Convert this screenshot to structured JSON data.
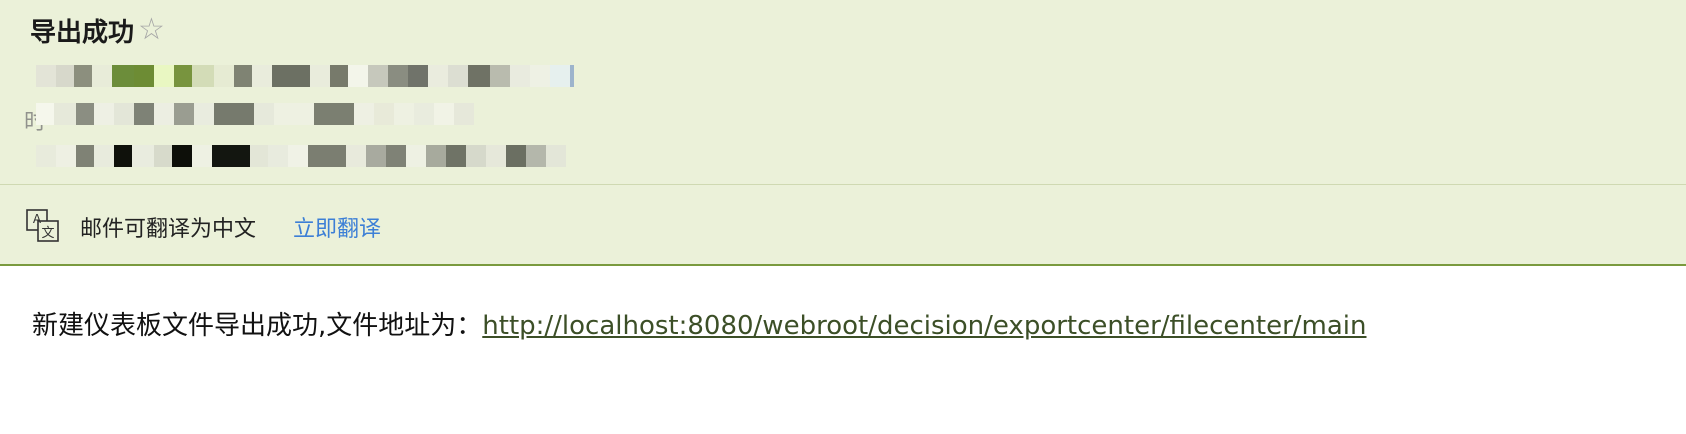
{
  "email": {
    "subject": "导出成功",
    "star_icon": "star-outline-icon",
    "redacted_label_fragment": "时"
  },
  "translate_bar": {
    "icon": "translate-icon",
    "message": "邮件可翻译为中文",
    "action_label": "立即翻译",
    "action_color": "#3c7fd6"
  },
  "content": {
    "prefix": "新建仪表板文件导出成功,文件地址为：",
    "link_text": "http://localhost:8080/webroot/decision/exportcenter/filecenter/main"
  },
  "colors": {
    "header_bg": "#ebf1d9",
    "divider": "#7a9a3e",
    "link": "#3c4f27"
  }
}
